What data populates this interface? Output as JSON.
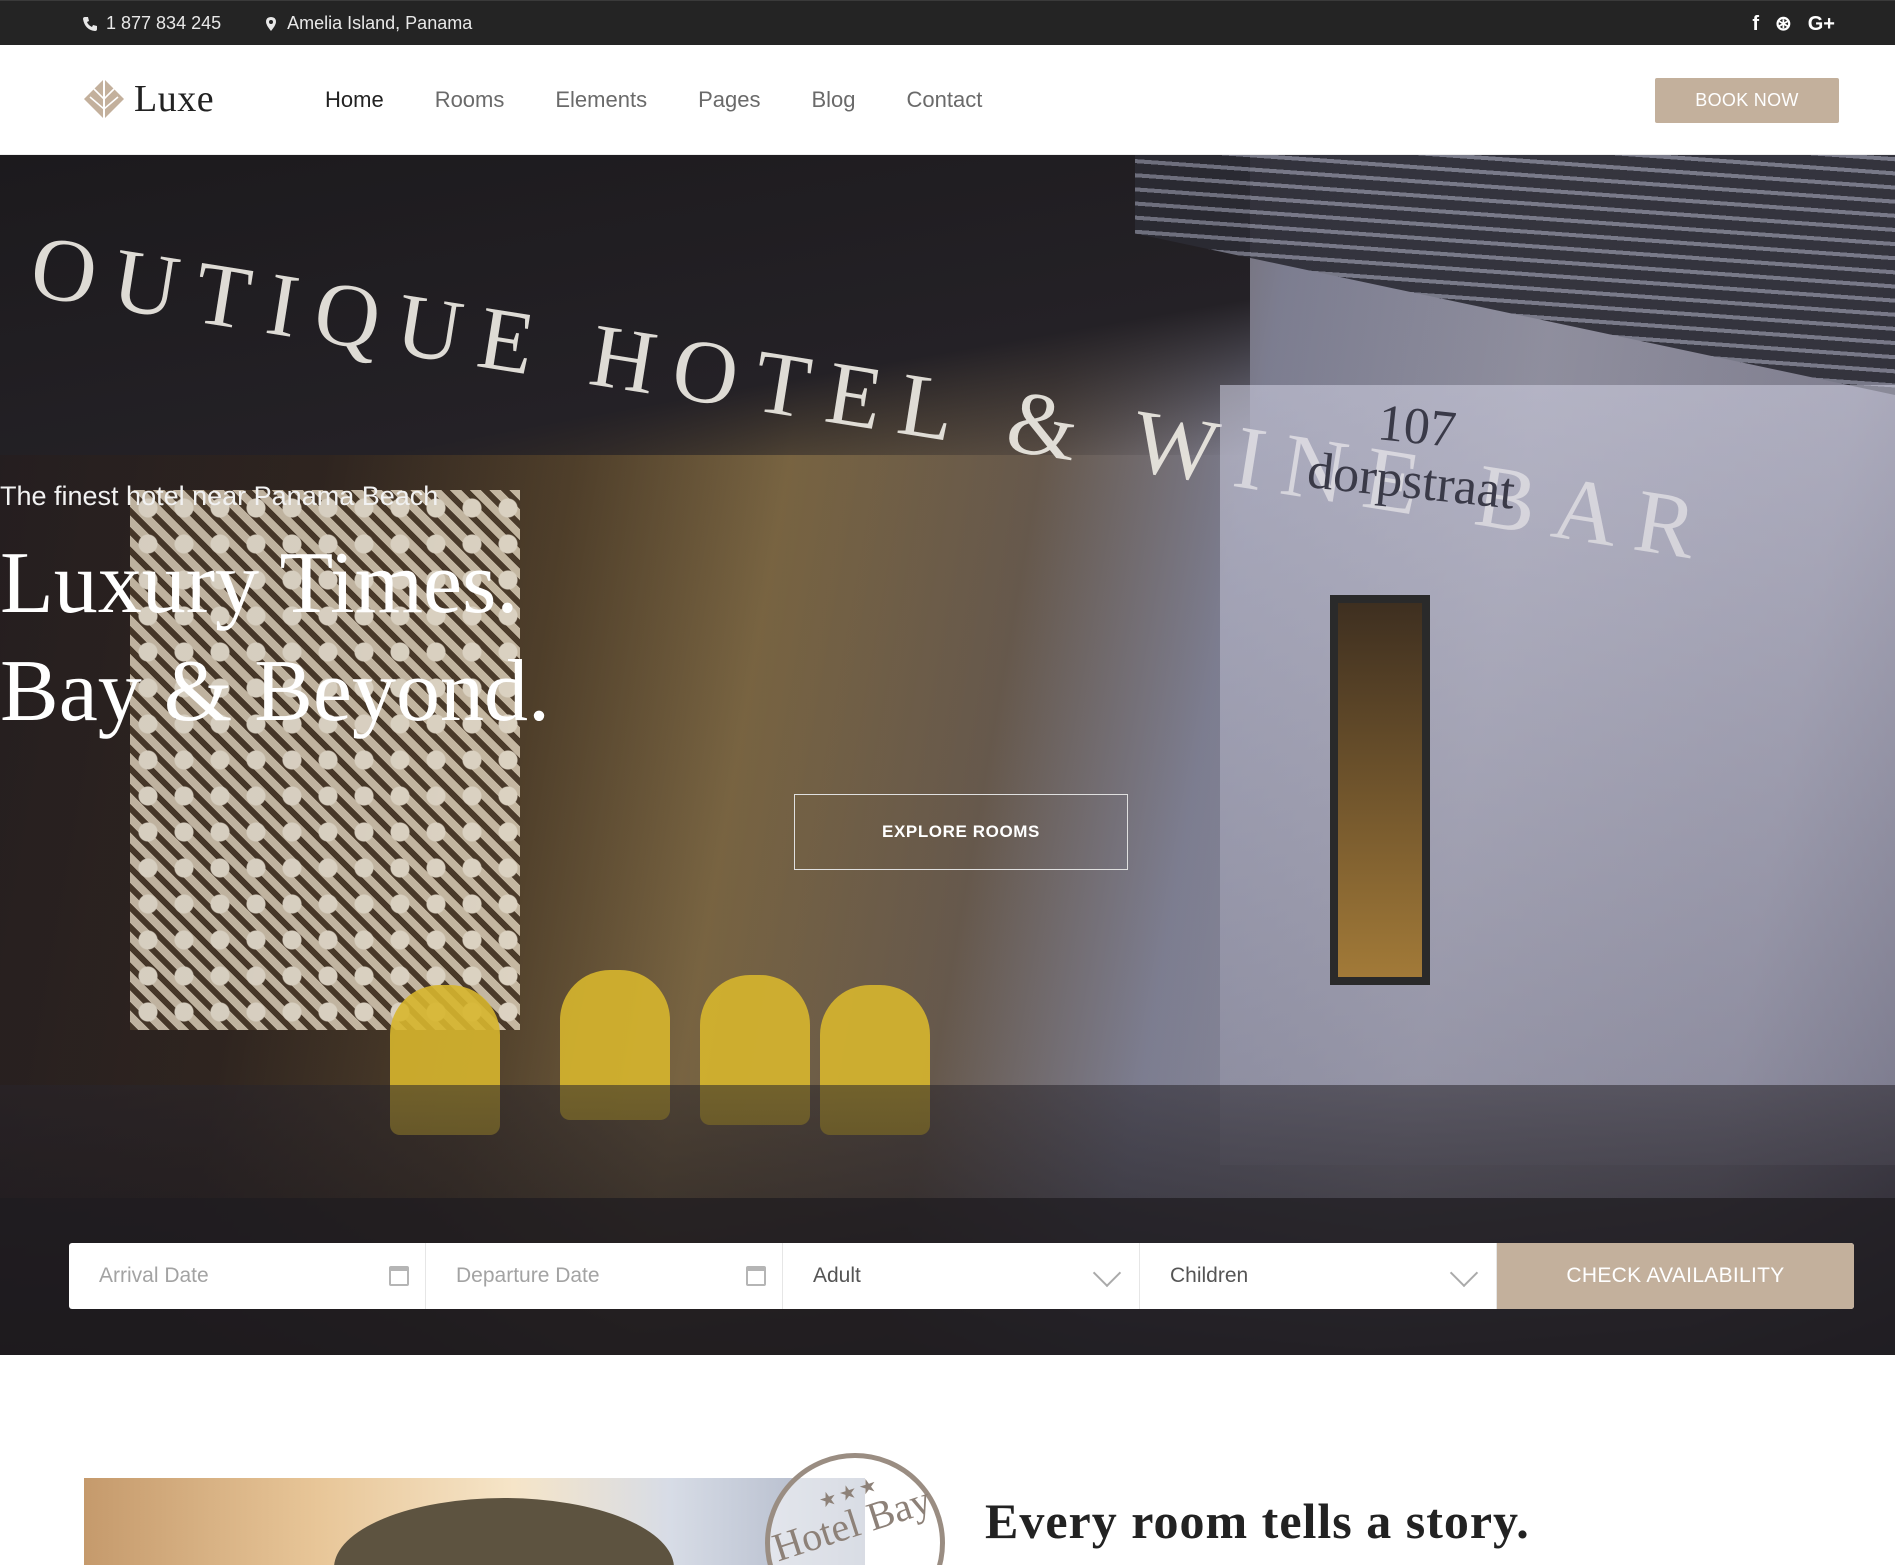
{
  "topbar": {
    "phone": "1 877 834 245",
    "location": "Amelia Island, Panama",
    "social": [
      "f",
      "⊛",
      "G+"
    ]
  },
  "header": {
    "logo_text": "Luxe",
    "nav": [
      {
        "label": "Home",
        "active": true
      },
      {
        "label": "Rooms",
        "active": false
      },
      {
        "label": "Elements",
        "active": false
      },
      {
        "label": "Pages",
        "active": false
      },
      {
        "label": "Blog",
        "active": false
      },
      {
        "label": "Contact",
        "active": false
      }
    ],
    "book_now": "BOOK NOW"
  },
  "hero": {
    "subtitle": "The finest hotel near Panama Beach",
    "title_line1": "Luxury Times.",
    "title_line2": "Bay & Beyond.",
    "cta": "EXPLORE ROOMS",
    "photo_sign": "OUTIQUE HOTEL & WINE BAR",
    "photo_number_line1": "107",
    "photo_number_line2": "dorpstraat"
  },
  "booking": {
    "arrival_placeholder": "Arrival Date",
    "departure_placeholder": "Departure Date",
    "adult_label": "Adult",
    "children_label": "Children",
    "check_button": "CHECK AVAILABILITY"
  },
  "about": {
    "stamp_stars": "★★★",
    "stamp_text": "Hotel Bay",
    "heading": "Every room tells a story."
  },
  "colors": {
    "accent": "#c3b09c",
    "topbar_bg": "#242424",
    "text_dark": "#222222"
  }
}
